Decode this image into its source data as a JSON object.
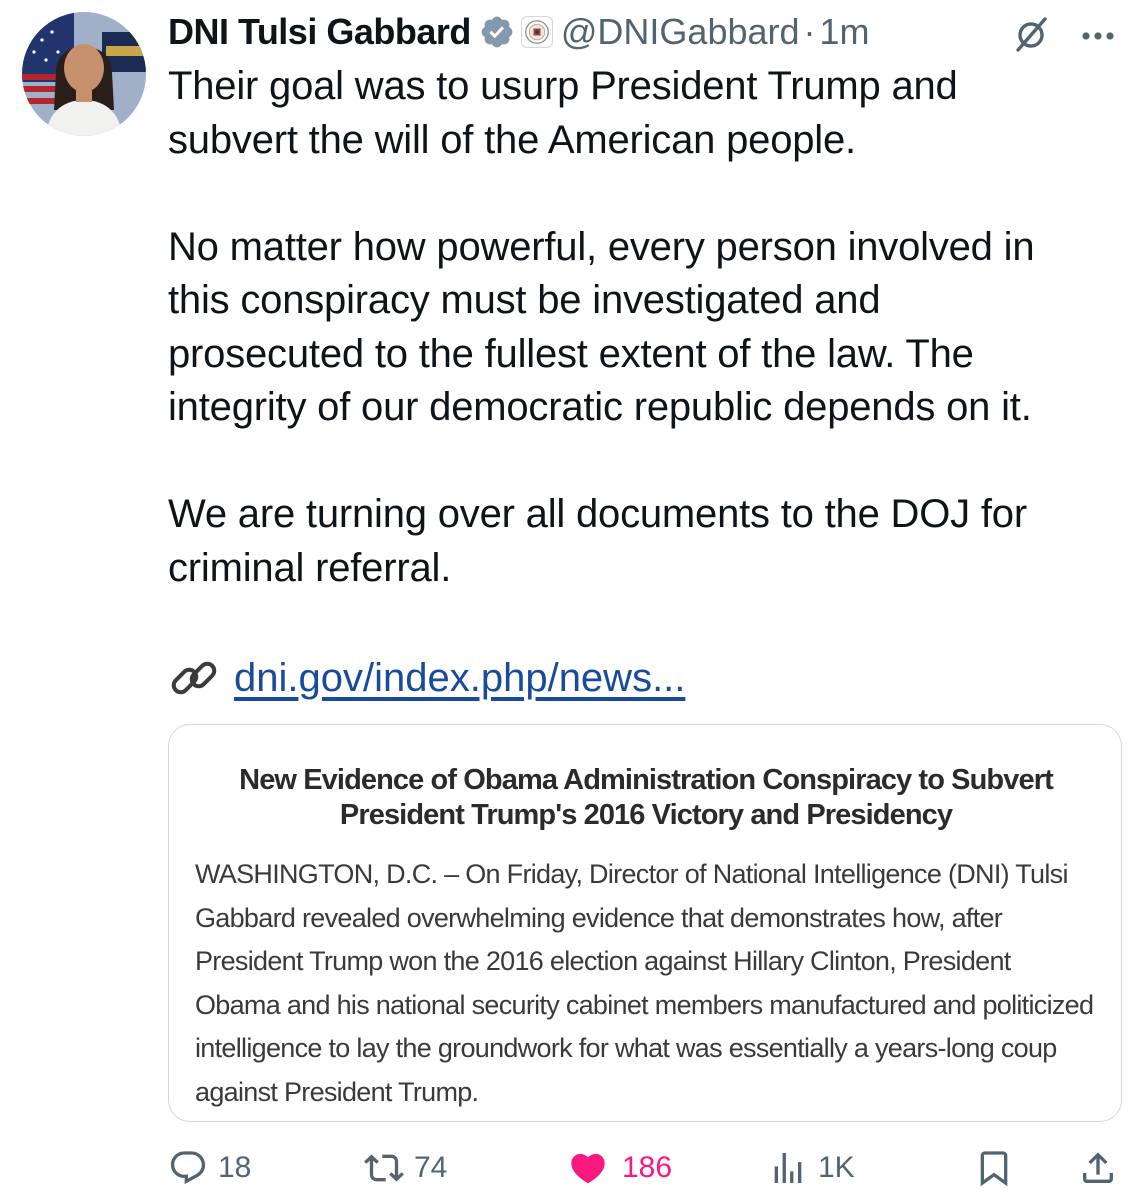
{
  "author": {
    "display_name": "DNI Tulsi Gabbard",
    "handle": "@DNIGabbard",
    "separator": "·",
    "time": "1m"
  },
  "tweet": {
    "paragraphs": [
      "Their goal was to usurp President Trump and\nsubvert the will of the American people.",
      "No matter how powerful, every person involved in\nthis conspiracy must be investigated and\nprosecuted to the fullest extent of the law. The\nintegrity of our democratic republic depends on it.",
      "We are turning over all documents to the DOJ for\ncriminal referral."
    ],
    "link_text": "dni.gov/index.php/news..."
  },
  "card": {
    "title": "New Evidence of Obama Administration Conspiracy to Subvert President Trump's 2016 Victory and Presidency",
    "body": "WASHINGTON, D.C. – On Friday, Director of National Intelligence (DNI) Tulsi Gabbard revealed overwhelming evidence that demonstrates how, after President Trump won the 2016 election against Hillary Clinton, President Obama and his national security cabinet members manufactured and politicized intelligence to lay the groundwork for what was essentially a years-long coup against President Trump."
  },
  "actions": {
    "replies": "18",
    "reposts": "74",
    "likes": "186",
    "views": "1K"
  },
  "colors": {
    "text": "#0f1419",
    "secondary": "#536471",
    "verified_badge": "#829aab",
    "like": "#f91880",
    "link": "#1a4b9a"
  },
  "icons": [
    "verified-badge-icon",
    "affiliate-seal-icon",
    "grok-icon",
    "more-icon",
    "link-icon",
    "reply-icon",
    "repost-icon",
    "like-icon",
    "views-icon",
    "bookmark-icon",
    "share-icon"
  ]
}
